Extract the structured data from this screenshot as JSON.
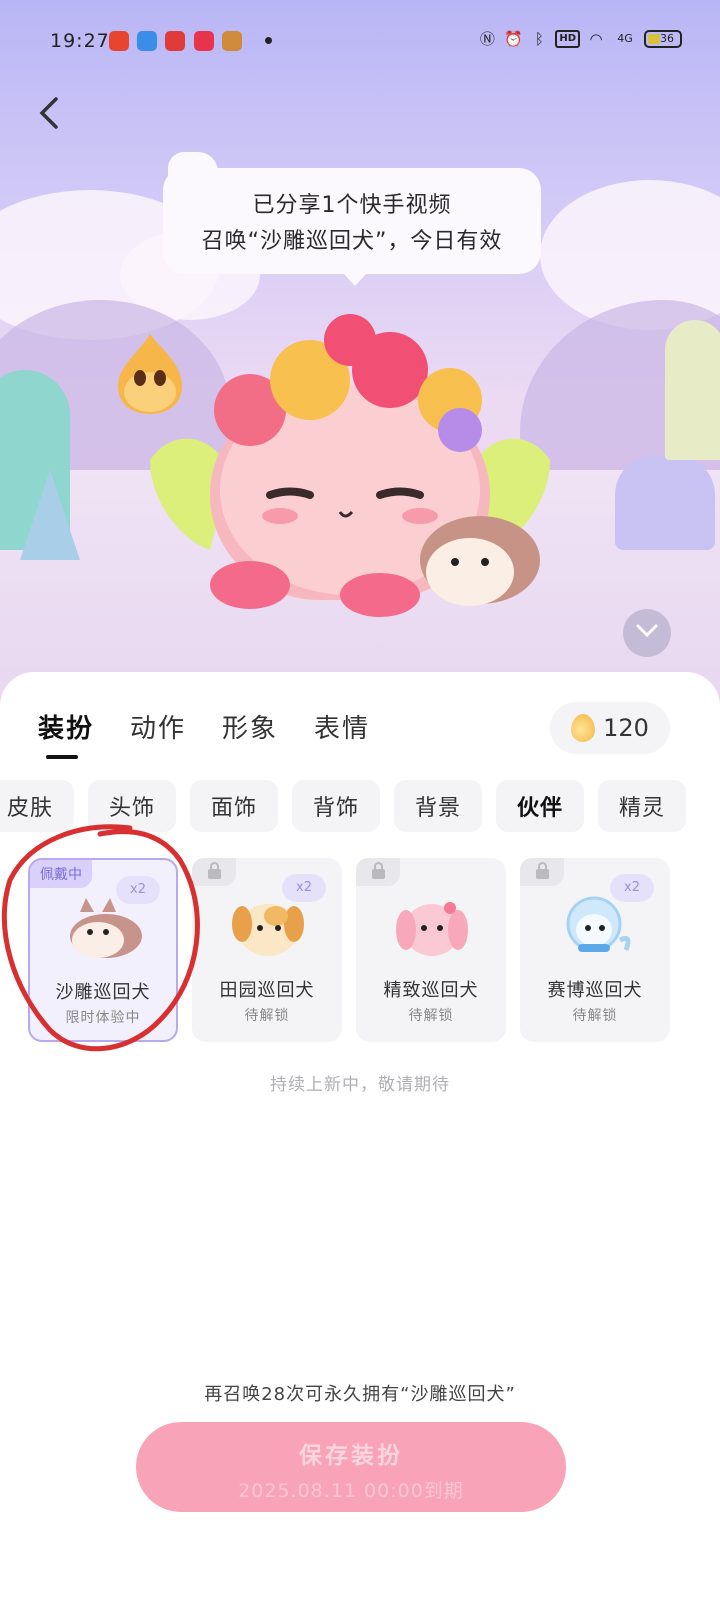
{
  "status_bar": {
    "time": "19:27",
    "network": "4G",
    "battery": "36",
    "hd": "HD"
  },
  "bubble": {
    "face": "ᵕ",
    "line1": "已分享1个快手视频",
    "line2": "召唤“沙雕巡回犬”，今日有效"
  },
  "tabs": [
    "装扮",
    "动作",
    "形象",
    "表情"
  ],
  "coin_count": "120",
  "categories": [
    "皮肤",
    "头饰",
    "面饰",
    "背饰",
    "背景",
    "伙伴",
    "精灵"
  ],
  "cards": [
    {
      "badge": "佩戴中",
      "multiplier": "x2",
      "name": "沙雕巡回犬",
      "status": "限时体验中"
    },
    {
      "multiplier": "x2",
      "name": "田园巡回犬",
      "status": "待解锁"
    },
    {
      "name": "精致巡回犬",
      "status": "待解锁"
    },
    {
      "multiplier": "x2",
      "name": "赛博巡回犬",
      "status": "待解锁"
    }
  ],
  "coming_soon": "持续上新中，敬请期待",
  "hint": "再召唤28次可永久拥有“沙雕巡回犬”",
  "save": {
    "label": "保存装扮",
    "expiry": "2025.08.11 00:00到期"
  },
  "colors": {
    "accent_purple": "#b8a9ef",
    "save_pink": "#f9a3b8",
    "annotation_red": "#d83030"
  }
}
